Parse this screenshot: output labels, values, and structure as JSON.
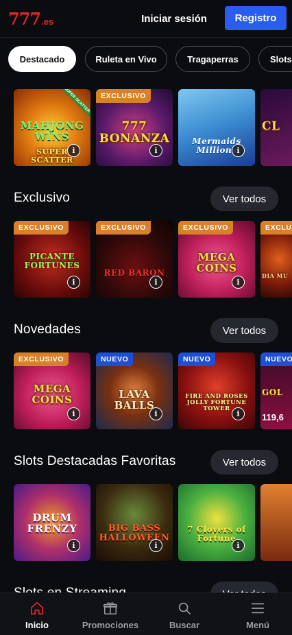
{
  "header": {
    "logo_main": "777",
    "logo_tld": ".es",
    "login_label": "Iniciar sesión",
    "register_label": "Registro"
  },
  "tabs": [
    {
      "label": "Destacado",
      "active": true
    },
    {
      "label": "Ruleta en Vivo",
      "active": false
    },
    {
      "label": "Tragaperras",
      "active": false
    },
    {
      "label": "Slots",
      "active": false
    }
  ],
  "featured": {
    "cards": [
      {
        "title": "MAHJONG WINS",
        "subtitle": "SUPER SCATTER",
        "badge": "",
        "ribbon": "SUPER SCATTER"
      },
      {
        "title": "777 BONANZA",
        "badge": "EXCLUSIVO"
      },
      {
        "title": "Mermaids Millions",
        "badge": ""
      },
      {
        "title": "CL",
        "badge": ""
      }
    ]
  },
  "sections": [
    {
      "title": "Exclusivo",
      "see_all": "Ver todos",
      "cards": [
        {
          "title": "PICANTE FORTUNES",
          "badge": "EXCLUSIVO"
        },
        {
          "title": "RED BARON",
          "badge": "EXCLUSIVO"
        },
        {
          "title": "MEGA COINS",
          "badge": "EXCLUSIVO"
        },
        {
          "title": "DIA MU",
          "badge": "EXCLUSIVO"
        }
      ]
    },
    {
      "title": "Novedades",
      "see_all": "Ver todos",
      "cards": [
        {
          "title": "MEGA COINS",
          "badge": "EXCLUSIVO"
        },
        {
          "title": "LAVA BALLS",
          "badge": "NUEVO"
        },
        {
          "title": "FIRE AND ROSES JOLLY FORTUNE TOWER",
          "badge": "NUEVO"
        },
        {
          "title": "GOL",
          "badge": "NUEVO",
          "jackpot": "119,6"
        }
      ]
    },
    {
      "title": "Slots Destacadas Favoritas",
      "see_all": "Ver todos",
      "cards": [
        {
          "title": "DRUM FRENZY",
          "badge": ""
        },
        {
          "title": "BIG BASS HALLOWEEN",
          "badge": ""
        },
        {
          "title": "7 Clovers of Fortune",
          "badge": ""
        },
        {
          "title": "",
          "badge": ""
        }
      ]
    },
    {
      "title": "Slots en Streaming",
      "see_all": "Ver todos"
    }
  ],
  "bottom_nav": [
    {
      "label": "Inicio",
      "icon": "home-icon",
      "active": true
    },
    {
      "label": "Promociones",
      "icon": "gift-icon",
      "active": false
    },
    {
      "label": "Buscar",
      "icon": "search-icon",
      "active": false
    },
    {
      "label": "Menú",
      "icon": "menu-icon",
      "active": false
    }
  ],
  "colors": {
    "brand_red": "#e3262a",
    "register_blue": "#2a5cf0",
    "badge_exclusive": "#d9802a",
    "badge_new": "#1e4fd4",
    "background": "#0b0c10"
  }
}
